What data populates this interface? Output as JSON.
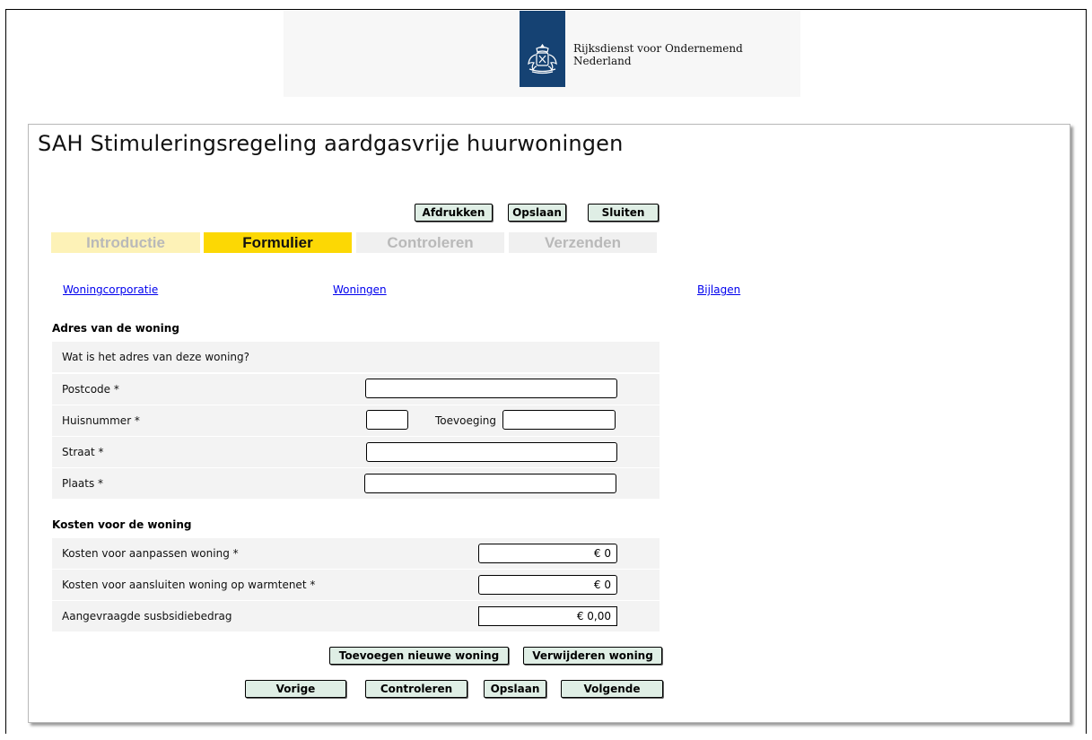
{
  "header": {
    "org_name_line1": "Rijksdienst voor Ondernemend",
    "org_name_line2": "Nederland"
  },
  "page": {
    "title": "SAH Stimuleringsregeling aardgasvrije huurwoningen"
  },
  "toolbar": {
    "print": "Afdrukken",
    "save": "Opslaan",
    "close": "Sluiten"
  },
  "steps": [
    {
      "label": "Introductie",
      "state": "done"
    },
    {
      "label": "Formulier",
      "state": "active"
    },
    {
      "label": "Controleren",
      "state": "pending"
    },
    {
      "label": "Verzenden",
      "state": "pending"
    }
  ],
  "nav_links": {
    "corporation": "Woningcorporatie",
    "homes": "Woningen",
    "attachments": "Bijlagen"
  },
  "address_section": {
    "heading": "Adres van de woning",
    "question": "Wat is het adres van deze woning?",
    "postcode_label": "Postcode *",
    "postcode_value": "",
    "housenumber_label": "Huisnummer *",
    "housenumber_value": "",
    "addition_label": "Toevoeging",
    "addition_value": "",
    "street_label": "Straat *",
    "street_value": "",
    "city_label": "Plaats *",
    "city_value": ""
  },
  "cost_section": {
    "heading": "Kosten voor de woning",
    "adjust_label": "Kosten voor aanpassen woning *",
    "adjust_value": "€ 0",
    "connect_label": "Kosten voor aansluiten woning op warmtenet *",
    "connect_value": "€ 0",
    "subsidy_label": "Aangevraagde susbsidiebedrag",
    "subsidy_value": "€ 0,00"
  },
  "actions": {
    "add_home": "Toevoegen nieuwe woning",
    "remove_home": "Verwijderen woning",
    "previous": "Vorige",
    "check": "Controleren",
    "save": "Opslaan",
    "next": "Volgende"
  },
  "colors": {
    "logo_blue": "#154273",
    "step_active": "#fcd804",
    "step_done": "#fdf2b7",
    "button_bg": "#dfeee5"
  }
}
